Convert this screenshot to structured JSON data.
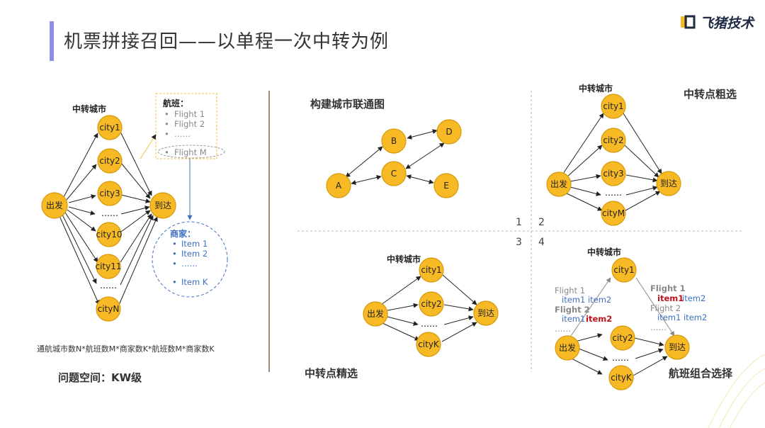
{
  "header": {
    "title": "机票拼接召回——以单程一次中转为例",
    "logo_text": "飞猪技术"
  },
  "left": {
    "transfer_city_label": "中转城市",
    "start": "出发",
    "end": "到达",
    "cities": [
      "city1",
      "city2",
      "city3",
      "……",
      "city10",
      "city11",
      "……",
      "cityN"
    ],
    "flight_box": {
      "title": "航班：",
      "items": [
        "Flight 1",
        "Flight 2",
        "……",
        "Flight M"
      ]
    },
    "merchant_box": {
      "title": "商家：",
      "items": [
        "Item 1",
        "Item 2",
        "……",
        "Item K"
      ]
    },
    "formula": "通航城市数N*航班数M*商家数K*航班数M*商家数K",
    "problem_space": "问题空间：KW级"
  },
  "q1": {
    "title": "构建城市联通图",
    "nodes": [
      "A",
      "B",
      "C",
      "D",
      "E"
    ]
  },
  "q2": {
    "title": "中转点粗选",
    "transfer_city_label": "中转城市",
    "start": "出发",
    "end": "到达",
    "cities": [
      "city1",
      "city2",
      "city3",
      "……",
      "cityM"
    ]
  },
  "q3": {
    "title": "中转点精选",
    "transfer_city_label": "中转城市",
    "start": "出发",
    "end": "到达",
    "cities": [
      "city1",
      "city2",
      "……",
      "cityK"
    ]
  },
  "q4": {
    "title": "航班组合选择",
    "transfer_city_label": "中转城市",
    "start": "出发",
    "end": "到达",
    "cities": [
      "city1",
      "city2",
      "……",
      "cityK"
    ],
    "left_flights": {
      "f1": "Flight 1",
      "f1_items": "item1 item2",
      "f2": "Flight 2",
      "f2_item1": "item1",
      "f2_item2": "item2",
      "more": "……"
    },
    "right_flights": {
      "f1": "Flight 1",
      "f1_item1": "item1",
      "f1_item2": "item2",
      "f2": "Flight 2",
      "f2_items": "item1 item2",
      "more": "……"
    }
  },
  "quadrant_numbers": [
    "1",
    "2",
    "3",
    "4"
  ],
  "colors": {
    "node_fill": "#f7b924",
    "accent_bar": "#8b8fe6",
    "divider": "#9e8a78",
    "highlight_red": "#c0121b",
    "item_blue": "#3d6fc2"
  }
}
